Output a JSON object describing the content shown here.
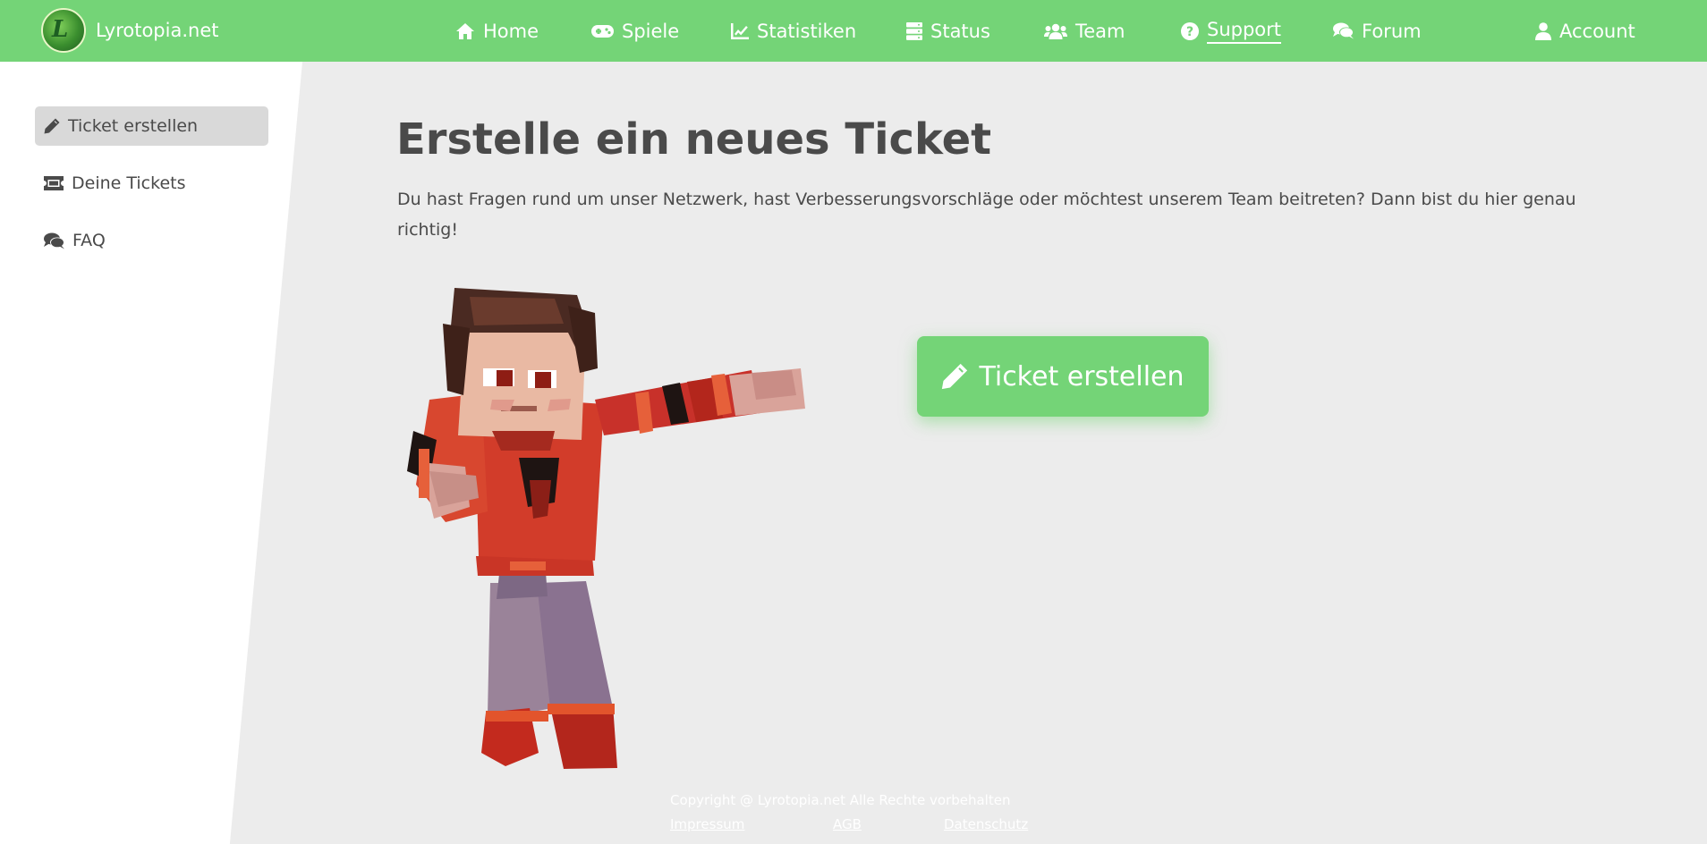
{
  "brand": {
    "name": "Lyrotopia.net",
    "logo_letter": "L"
  },
  "nav": {
    "items": [
      {
        "label": "Home",
        "icon": "home-icon"
      },
      {
        "label": "Spiele",
        "icon": "gamepad-icon"
      },
      {
        "label": "Statistiken",
        "icon": "chart-line-icon"
      },
      {
        "label": "Status",
        "icon": "server-icon"
      },
      {
        "label": "Team",
        "icon": "users-icon"
      },
      {
        "label": "Support",
        "icon": "question-circle-icon",
        "active": true
      },
      {
        "label": "Forum",
        "icon": "comments-icon"
      }
    ],
    "account": {
      "label": "Account",
      "icon": "user-icon"
    }
  },
  "sidebar": {
    "items": [
      {
        "label": "Ticket erstellen",
        "icon": "pencil-icon",
        "active": true
      },
      {
        "label": "Deine Tickets",
        "icon": "ticket-icon"
      },
      {
        "label": "FAQ",
        "icon": "comments-icon"
      }
    ]
  },
  "main": {
    "title": "Erstelle ein neues Ticket",
    "description": "Du hast Fragen rund um unser Netzwerk, hast Verbesserungsvorschläge oder möchtest unserem Team beitreten? Dann bist du hier genau richtig!",
    "cta_label": "Ticket erstellen",
    "cta_icon": "pencil-icon"
  },
  "footer": {
    "copyright": "Copyright @ Lyrotopia.net Alle Rechte vorbehalten",
    "links": [
      "Impressum",
      "AGB",
      "Datenschutz"
    ]
  },
  "colors": {
    "accent": "#74d477",
    "background": "#ececec",
    "sidebar": "#ffffff",
    "text": "#4a4a4a",
    "active_item": "#d9d9d9"
  }
}
